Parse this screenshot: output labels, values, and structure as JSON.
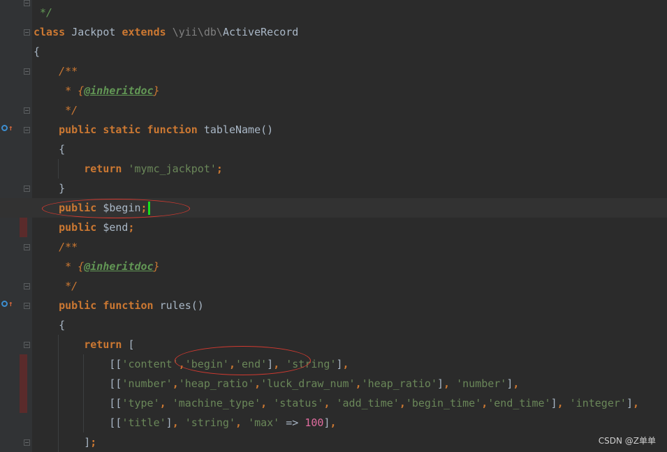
{
  "editor": {
    "lines": [
      {
        "tokens": [
          {
            "t": "cmt",
            "v": " */"
          }
        ]
      },
      {
        "tokens": [
          {
            "t": "kw",
            "v": "class "
          },
          {
            "t": "cls",
            "v": "Jackpot "
          },
          {
            "t": "kw",
            "v": "extends "
          },
          {
            "t": "ns",
            "v": "\\yii\\db\\"
          },
          {
            "t": "cls",
            "v": "ActiveRecord"
          }
        ]
      },
      {
        "tokens": [
          {
            "t": "p",
            "v": "{"
          }
        ]
      },
      {
        "tokens": [
          {
            "t": "dcmt",
            "v": "    /**"
          }
        ]
      },
      {
        "tokens": [
          {
            "t": "dcmt",
            "v": "     * {"
          },
          {
            "t": "tag",
            "v": "@inheritdoc"
          },
          {
            "t": "dcmt",
            "v": "}"
          }
        ]
      },
      {
        "tokens": [
          {
            "t": "dcmt",
            "v": "     */"
          }
        ]
      },
      {
        "tokens": [
          {
            "t": "kw",
            "v": "    public static function "
          },
          {
            "t": "p",
            "v": "tableName()"
          }
        ]
      },
      {
        "tokens": [
          {
            "t": "p",
            "v": "    {"
          }
        ]
      },
      {
        "tokens": [
          {
            "t": "kw",
            "v": "        return "
          },
          {
            "t": "str",
            "v": "'mymc_jackpot'"
          },
          {
            "t": "kw",
            "v": ";"
          }
        ]
      },
      {
        "tokens": [
          {
            "t": "p",
            "v": "    }"
          }
        ]
      },
      {
        "tokens": [
          {
            "t": "kw",
            "v": "    public "
          },
          {
            "t": "var",
            "v": "$begin"
          },
          {
            "t": "kw",
            "v": ";"
          }
        ]
      },
      {
        "tokens": [
          {
            "t": "kw",
            "v": "    public "
          },
          {
            "t": "var",
            "v": "$end"
          },
          {
            "t": "kw",
            "v": ";"
          }
        ]
      },
      {
        "tokens": [
          {
            "t": "dcmt",
            "v": "    /**"
          }
        ]
      },
      {
        "tokens": [
          {
            "t": "dcmt",
            "v": "     * {"
          },
          {
            "t": "tag",
            "v": "@inheritdoc"
          },
          {
            "t": "dcmt",
            "v": "}"
          }
        ]
      },
      {
        "tokens": [
          {
            "t": "dcmt",
            "v": "     */"
          }
        ]
      },
      {
        "tokens": [
          {
            "t": "kw",
            "v": "    public function "
          },
          {
            "t": "p",
            "v": "rules()"
          }
        ]
      },
      {
        "tokens": [
          {
            "t": "p",
            "v": "    {"
          }
        ]
      },
      {
        "tokens": [
          {
            "t": "kw",
            "v": "        return "
          },
          {
            "t": "p",
            "v": "["
          }
        ]
      },
      {
        "tokens": [
          {
            "t": "p",
            "v": "            [["
          },
          {
            "t": "str",
            "v": "'content'"
          },
          {
            "t": "kw",
            "v": ","
          },
          {
            "t": "str",
            "v": "'begin'"
          },
          {
            "t": "kw",
            "v": ","
          },
          {
            "t": "str",
            "v": "'end'"
          },
          {
            "t": "p",
            "v": "]"
          },
          {
            "t": "kw",
            "v": ", "
          },
          {
            "t": "str",
            "v": "'string'"
          },
          {
            "t": "p",
            "v": "]"
          },
          {
            "t": "kw",
            "v": ","
          }
        ]
      },
      {
        "tokens": [
          {
            "t": "p",
            "v": "            [["
          },
          {
            "t": "str",
            "v": "'number'"
          },
          {
            "t": "kw",
            "v": ","
          },
          {
            "t": "str",
            "v": "'heap_ratio'"
          },
          {
            "t": "kw",
            "v": ","
          },
          {
            "t": "str",
            "v": "'luck_draw_num'"
          },
          {
            "t": "kw",
            "v": ","
          },
          {
            "t": "str",
            "v": "'heap_ratio'"
          },
          {
            "t": "p",
            "v": "]"
          },
          {
            "t": "kw",
            "v": ", "
          },
          {
            "t": "str",
            "v": "'number'"
          },
          {
            "t": "p",
            "v": "]"
          },
          {
            "t": "kw",
            "v": ","
          }
        ]
      },
      {
        "tokens": [
          {
            "t": "p",
            "v": "            [["
          },
          {
            "t": "str",
            "v": "'type'"
          },
          {
            "t": "kw",
            "v": ", "
          },
          {
            "t": "str",
            "v": "'machine_type'"
          },
          {
            "t": "kw",
            "v": ", "
          },
          {
            "t": "str",
            "v": "'status'"
          },
          {
            "t": "kw",
            "v": ", "
          },
          {
            "t": "str",
            "v": "'add_time'"
          },
          {
            "t": "kw",
            "v": ","
          },
          {
            "t": "str",
            "v": "'begin_time'"
          },
          {
            "t": "kw",
            "v": ","
          },
          {
            "t": "str",
            "v": "'end_time'"
          },
          {
            "t": "p",
            "v": "]"
          },
          {
            "t": "kw",
            "v": ", "
          },
          {
            "t": "str",
            "v": "'integer'"
          },
          {
            "t": "p",
            "v": "]"
          },
          {
            "t": "kw",
            "v": ","
          }
        ]
      },
      {
        "tokens": [
          {
            "t": "p",
            "v": "            [["
          },
          {
            "t": "str",
            "v": "'title'"
          },
          {
            "t": "p",
            "v": "]"
          },
          {
            "t": "kw",
            "v": ", "
          },
          {
            "t": "str",
            "v": "'string'"
          },
          {
            "t": "kw",
            "v": ", "
          },
          {
            "t": "str",
            "v": "'max'"
          },
          {
            "t": "p",
            "v": " => "
          },
          {
            "t": "num",
            "v": "100"
          },
          {
            "t": "p",
            "v": "]"
          },
          {
            "t": "kw",
            "v": ","
          }
        ]
      },
      {
        "tokens": [
          {
            "t": "p",
            "v": "        ]"
          },
          {
            "t": "kw",
            "v": ";"
          }
        ]
      }
    ]
  },
  "watermark": "CSDN @Z单单",
  "colors": {
    "background": "#2b2b2b",
    "keyword": "#cc7832",
    "string": "#6a8759",
    "number": "#e06c9f",
    "annotation": "#d33a30",
    "caret": "#18e01c"
  }
}
